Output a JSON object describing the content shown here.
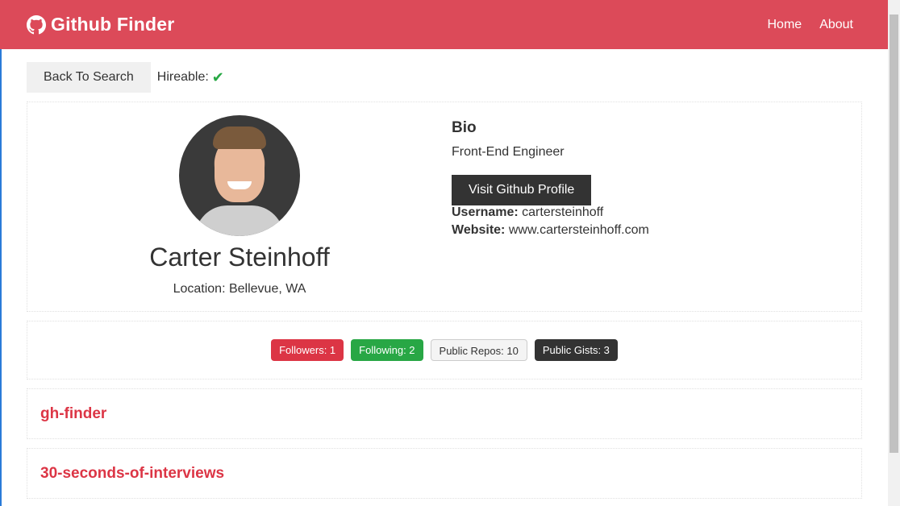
{
  "navbar": {
    "brand": "Github Finder",
    "links": [
      "Home",
      "About"
    ]
  },
  "top": {
    "back_label": "Back To Search",
    "hireable_label": "Hireable:",
    "hireable_icon": "check-icon"
  },
  "profile": {
    "name": "Carter Steinhoff",
    "location_label": "Location: Bellevue, WA",
    "bio_title": "Bio",
    "bio": "Front-End Engineer",
    "visit_label": "Visit Github Profile",
    "username_key": "Username:",
    "username": "cartersteinhoff",
    "website_key": "Website:",
    "website": "www.cartersteinhoff.com"
  },
  "stats": {
    "followers": "Followers: 1",
    "following": "Following: 2",
    "repos": "Public Repos: 10",
    "gists": "Public Gists: 3"
  },
  "repos": [
    "gh-finder",
    "30-seconds-of-interviews"
  ],
  "colors": {
    "navbar": "#dc4a59",
    "accent_red": "#dc3545",
    "accent_green": "#28a745",
    "dark": "#333333"
  }
}
